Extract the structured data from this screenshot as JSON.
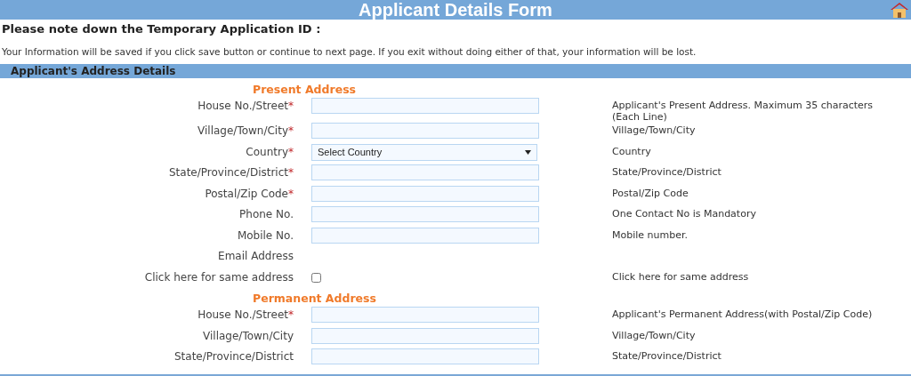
{
  "header": {
    "title": "Applicant Details Form"
  },
  "notice": "Please note down the Temporary Application ID :",
  "info": "Your Information will be saved if you click save button or continue to next page. If you exit without doing either of that, your information will be lost.",
  "section": {
    "title": "Applicant's Address Details"
  },
  "rows": [
    {
      "kind": "heading",
      "label": "Present Address"
    },
    {
      "kind": "text",
      "label": "House No./Street",
      "mark": "*",
      "hint": "Applicant's Present Address. Maximum 35 characters (Each Line)"
    },
    {
      "kind": "text",
      "label": "Village/Town/City",
      "mark": "*",
      "hint": "Village/Town/City"
    },
    {
      "kind": "select",
      "label": "Country",
      "mark": "*",
      "value": "Select Country",
      "hint": "Country"
    },
    {
      "kind": "text",
      "label": "State/Province/District",
      "mark": "*",
      "hint": "State/Province/District"
    },
    {
      "kind": "text",
      "label": "Postal/Zip Code",
      "mark": "*",
      "hint": "Postal/Zip Code"
    },
    {
      "kind": "text",
      "label": "Phone No.",
      "hint": "One Contact No is Mandatory"
    },
    {
      "kind": "text",
      "label": "Mobile No.",
      "hint": "Mobile number."
    },
    {
      "kind": "none",
      "label": "Email Address"
    },
    {
      "kind": "checkbox",
      "label": "Click here for same address",
      "checked": false,
      "hint": "Click here for same address"
    },
    {
      "kind": "heading",
      "label": "Permanent Address"
    },
    {
      "kind": "text",
      "label": "House No./Street",
      "mark": "*",
      "hint": "Applicant's Permanent Address(with Postal/Zip Code)"
    },
    {
      "kind": "text",
      "label": "Village/Town/City",
      "hint": "Village/Town/City"
    },
    {
      "kind": "text",
      "label": "State/Province/District",
      "hint": "State/Province/District"
    }
  ]
}
